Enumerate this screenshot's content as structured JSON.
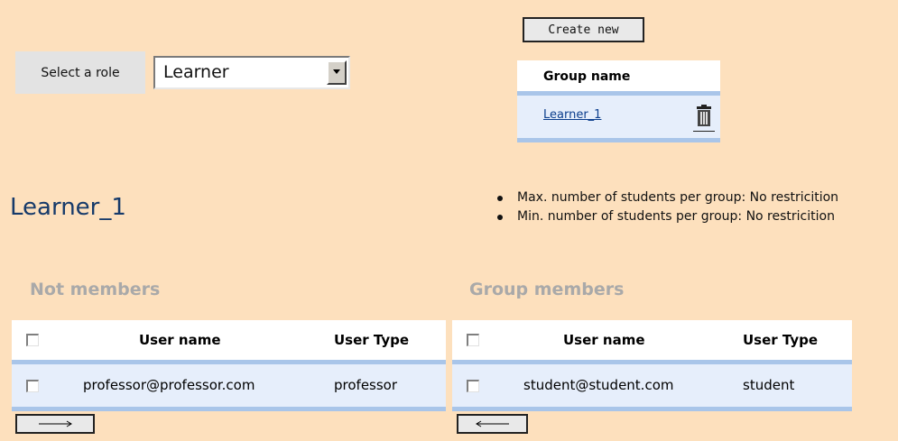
{
  "role": {
    "label": "Select a role",
    "selected": "Learner"
  },
  "groups": {
    "create_label": "Create new",
    "header": "Group name",
    "rows": [
      {
        "name": "Learner_1"
      }
    ]
  },
  "group_title": "Learner_1",
  "restrictions": [
    "Max. number of students per group: No restricition",
    "Min. number of students per group: No restricition"
  ],
  "not_members": {
    "title": "Not members",
    "columns": [
      "User name",
      "User Type"
    ],
    "rows": [
      {
        "user": "professor@professor.com",
        "type": "professor"
      }
    ],
    "move_button": "——>"
  },
  "members": {
    "title": "Group members",
    "columns": [
      "User name",
      "User Type"
    ],
    "rows": [
      {
        "user": "student@student.com",
        "type": "student"
      }
    ],
    "move_button": "<——"
  }
}
